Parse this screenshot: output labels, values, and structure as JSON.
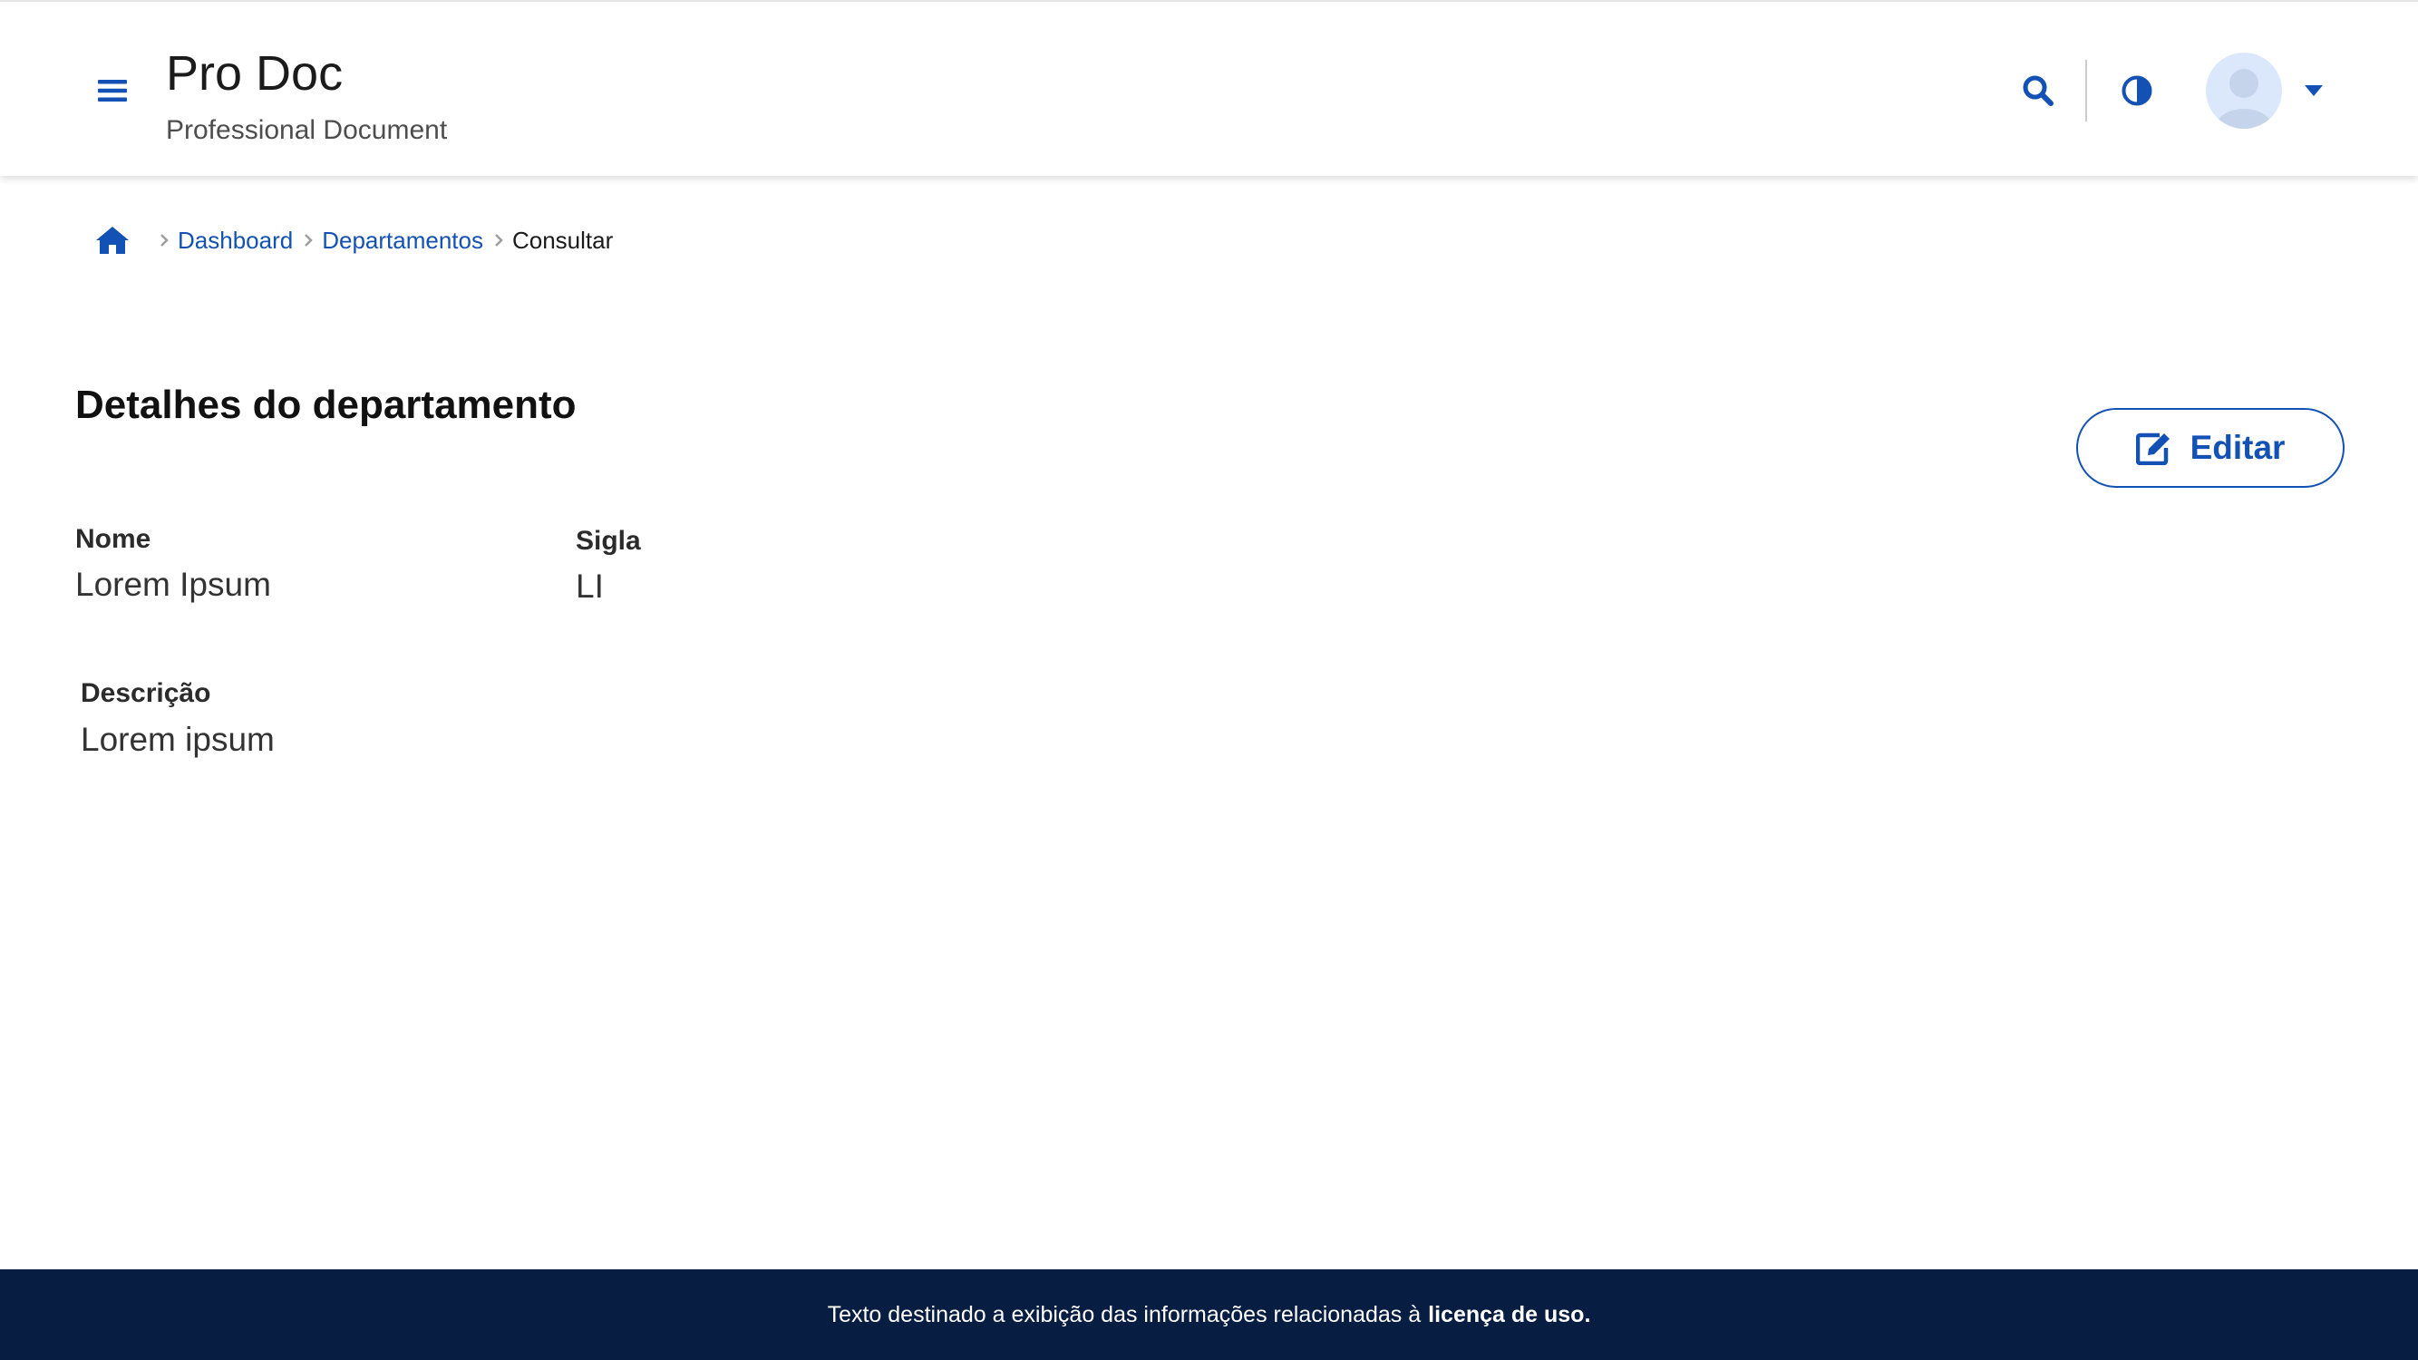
{
  "header": {
    "title": "Pro Doc",
    "subtitle": "Professional Document",
    "icons": {
      "menu": "menu-icon",
      "search": "search-icon",
      "contrast": "contrast-icon",
      "avatar": "user-avatar",
      "dropdown": "caret-down-icon"
    }
  },
  "breadcrumb": {
    "home_icon": "home-icon",
    "items": [
      {
        "label": "Dashboard"
      },
      {
        "label": "Departamentos"
      },
      {
        "label": "Consultar"
      }
    ]
  },
  "main": {
    "title": "Detalhes do departamento",
    "edit_button": {
      "label": "Editar",
      "icon": "edit-icon"
    },
    "fields": {
      "nome": {
        "label": "Nome",
        "value": "Lorem Ipsum"
      },
      "sigla": {
        "label": "Sigla",
        "value": "LI"
      },
      "descricao": {
        "label": "Descrição",
        "value": "Lorem ipsum"
      }
    }
  },
  "footer": {
    "text": "Texto destinado a exibição das informações relacionadas à",
    "link": "licença de uso."
  },
  "colors": {
    "primary": "#1351b4",
    "footer_bg": "#071d41",
    "avatar_bg": "#dbe8fb",
    "text": "#1b1b1b"
  }
}
